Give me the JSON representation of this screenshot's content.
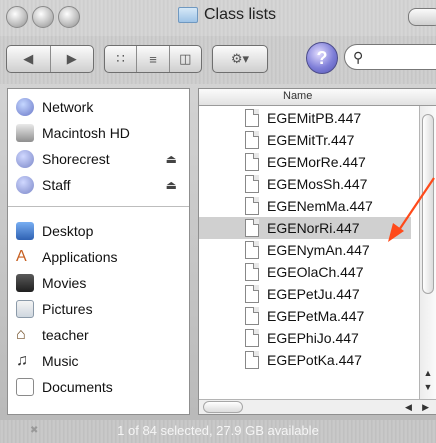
{
  "window": {
    "title": "Class lists"
  },
  "toolbar": {
    "back_icon": "back-arrow-icon",
    "forward_icon": "forward-arrow-icon",
    "view_icons": [
      "icon-view-icon",
      "list-view-icon",
      "column-view-icon"
    ],
    "action_icon": "gear-icon",
    "help_label": "?",
    "search_icon": "search-icon"
  },
  "sidebar": {
    "items": [
      {
        "label": "Network",
        "icon": "network-globe-icon",
        "eject": ""
      },
      {
        "label": "Macintosh HD",
        "icon": "hard-drive-icon",
        "eject": ""
      },
      {
        "label": "Shorecrest",
        "icon": "network-volume-icon",
        "eject": "⏏"
      },
      {
        "label": "Staff",
        "icon": "network-volume-icon",
        "eject": "⏏"
      },
      {
        "label": "Desktop",
        "icon": "desktop-icon",
        "eject": ""
      },
      {
        "label": "Applications",
        "icon": "applications-icon",
        "eject": ""
      },
      {
        "label": "Movies",
        "icon": "movies-icon",
        "eject": ""
      },
      {
        "label": "Pictures",
        "icon": "pictures-icon",
        "eject": ""
      },
      {
        "label": "teacher",
        "icon": "home-icon",
        "eject": ""
      },
      {
        "label": "Music",
        "icon": "music-icon",
        "eject": ""
      },
      {
        "label": "Documents",
        "icon": "documents-icon",
        "eject": ""
      }
    ]
  },
  "filelist": {
    "column_header": "Name",
    "files": [
      "EGEMitPB.447",
      "EGEMitTr.447",
      "EGEMorRe.447",
      "EGEMosSh.447",
      "EGENemMa.447",
      "EGENorRi.447",
      "EGENymAn.447",
      "EGEOlaCh.447",
      "EGEPetJu.447",
      "EGEPetMa.447",
      "EGEPhiJo.447",
      "EGEPotKa.447"
    ],
    "selected": "EGENorRi.447"
  },
  "status": {
    "text": "1 of 84 selected, 27.9 GB available"
  },
  "colors": {
    "annotation_arrow": "#ff4a1a",
    "selection": "#d0d0d0"
  }
}
